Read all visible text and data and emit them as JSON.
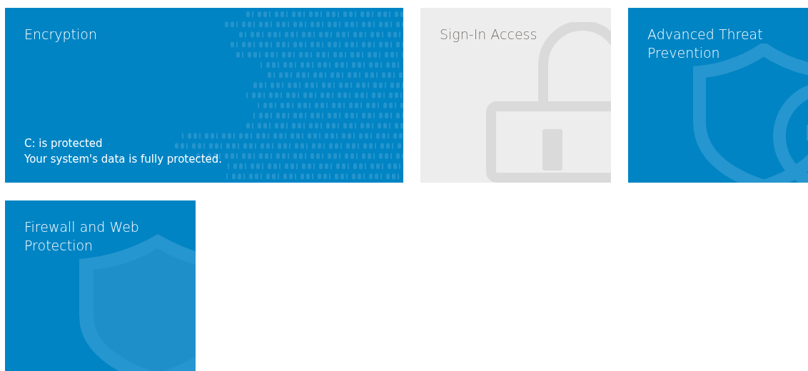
{
  "tiles": [
    {
      "kind": "encryption",
      "title": "Encryption",
      "disabled": false,
      "status": [
        "C: is protected",
        "Your system's data is fully protected."
      ]
    },
    {
      "kind": "lock",
      "title": "Sign-In Access",
      "disabled": true
    },
    {
      "kind": "shield-plus",
      "title": "Advanced Threat Prevention",
      "disabled": false
    },
    {
      "kind": "shield",
      "title": "Firewall and Web Protection",
      "disabled": false
    }
  ]
}
